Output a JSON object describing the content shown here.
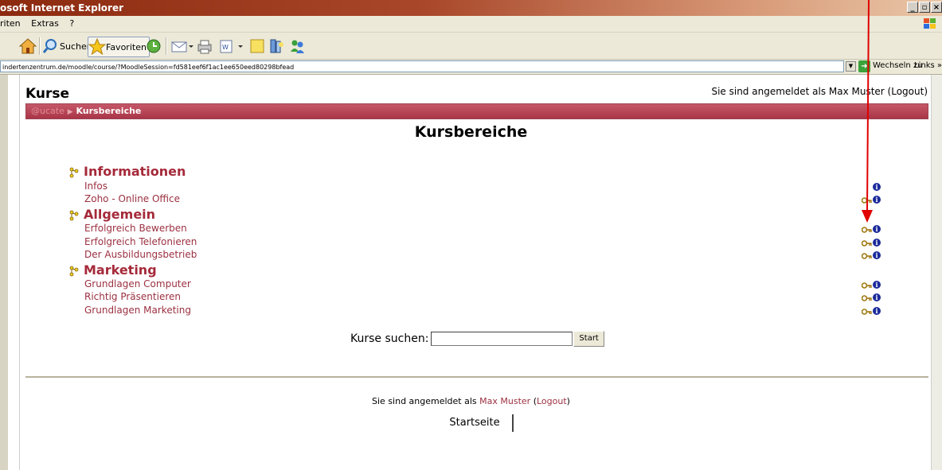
{
  "window": {
    "title": "osoft Internet Explorer",
    "buttons": [
      "_",
      "▫",
      "×"
    ]
  },
  "menu": {
    "items": [
      "riten",
      "Extras",
      "?"
    ]
  },
  "toolbar": {
    "search_label": "Suchen",
    "favorites_label": "Favoriten"
  },
  "address": {
    "url": "indertenzentrum.de/moodle/course/?MoodleSession=fd581eef6f1ac1ee650eed80298bfead",
    "go_label": "Wechseln zu",
    "links_label": "Links »"
  },
  "page": {
    "header": "Kurse",
    "login_prefix": "Sie sind angemeldet als Max Muster (Logout)",
    "breadcrumb": {
      "home": "@ucate",
      "current": "Kursbereiche"
    },
    "title": "Kursbereiche"
  },
  "categories": [
    {
      "name": "Informationen",
      "courses": [
        {
          "name": "Infos",
          "key": false
        },
        {
          "name": "Zoho - Online Office",
          "key": true
        }
      ]
    },
    {
      "name": "Allgemein",
      "courses": [
        {
          "name": "Erfolgreich Bewerben",
          "key": true
        },
        {
          "name": "Erfolgreich Telefonieren",
          "key": true
        },
        {
          "name": "Der Ausbildungsbetrieb",
          "key": true
        }
      ]
    },
    {
      "name": "Marketing",
      "courses": [
        {
          "name": "Grundlagen Computer",
          "key": true
        },
        {
          "name": "Richtig Präsentieren",
          "key": true
        },
        {
          "name": "Grundlagen Marketing",
          "key": true
        }
      ]
    }
  ],
  "search": {
    "label": "Kurse suchen:",
    "button": "Start",
    "value": ""
  },
  "footer": {
    "login_text": "Sie sind angemeldet als",
    "user": "Max Muster",
    "logout": "Logout",
    "home_button": "Startseite"
  },
  "colors": {
    "accent": "#a52a3a",
    "link": "#9b3040",
    "navbar": "#b84656"
  }
}
